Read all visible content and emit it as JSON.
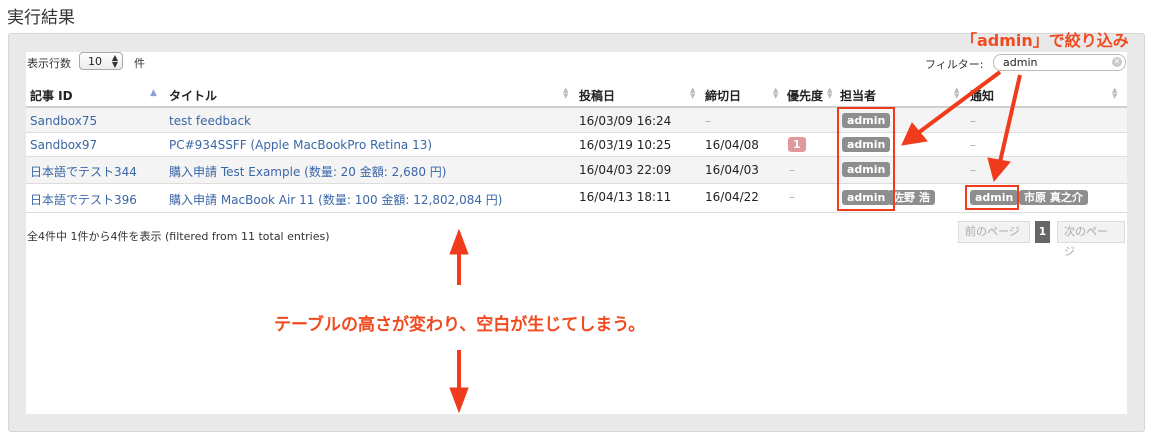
{
  "page": {
    "title": "実行結果"
  },
  "controls": {
    "rows_label": "表示行数",
    "rows_value": "10",
    "rows_suffix": "件",
    "filter_label": "フィルター:",
    "filter_value": "admin"
  },
  "columns": [
    {
      "label": "記事 ID",
      "sorted": "asc"
    },
    {
      "label": "タイトル"
    },
    {
      "label": "投稿日"
    },
    {
      "label": "締切日"
    },
    {
      "label": "優先度"
    },
    {
      "label": "担当者"
    },
    {
      "label": "通知"
    }
  ],
  "rows": [
    {
      "id": "Sandbox75",
      "title": "test feedback",
      "posted": "16/03/09 16:24",
      "due": "–",
      "priority": "",
      "assignees": [
        "admin"
      ],
      "notify": []
    },
    {
      "id": "Sandbox97",
      "title": "PC#934SSFF (Apple MacBookPro Retina 13)",
      "posted": "16/03/19 10:25",
      "due": "16/04/08",
      "priority": "1",
      "assignees": [
        "admin"
      ],
      "notify": []
    },
    {
      "id": "日本語でテスト344",
      "title": "購入申請 Test Example (数量: 20 金額: 2,680 円)",
      "posted": "16/04/03 22:09",
      "due": "16/04/03",
      "priority": "",
      "assignees": [
        "admin"
      ],
      "notify": []
    },
    {
      "id": "日本語でテスト396",
      "title": "購入申請 MacBook Air 11 (数量: 100 金額: 12,802,084 円)",
      "posted": "16/04/13 18:11",
      "due": "16/04/22",
      "priority": "",
      "assignees": [
        "admin",
        "佐野 浩"
      ],
      "notify": [
        "admin",
        "市原 真之介"
      ]
    }
  ],
  "dash": "–",
  "footer": {
    "info": "全4件中 1件から4件を表示 (filtered from 11 total entries)",
    "prev": "前のページ",
    "page": "1",
    "next": "次のページ"
  },
  "annotations": {
    "filter_note": "「admin」で絞り込み",
    "height_note": "テーブルの高さが変わり、空白が生じてしまう。"
  },
  "colors": {
    "accent_red": "#f03c1c",
    "link": "#3a66a7",
    "badge": "#8e8e8e",
    "priority_badge": "#e0999b"
  }
}
